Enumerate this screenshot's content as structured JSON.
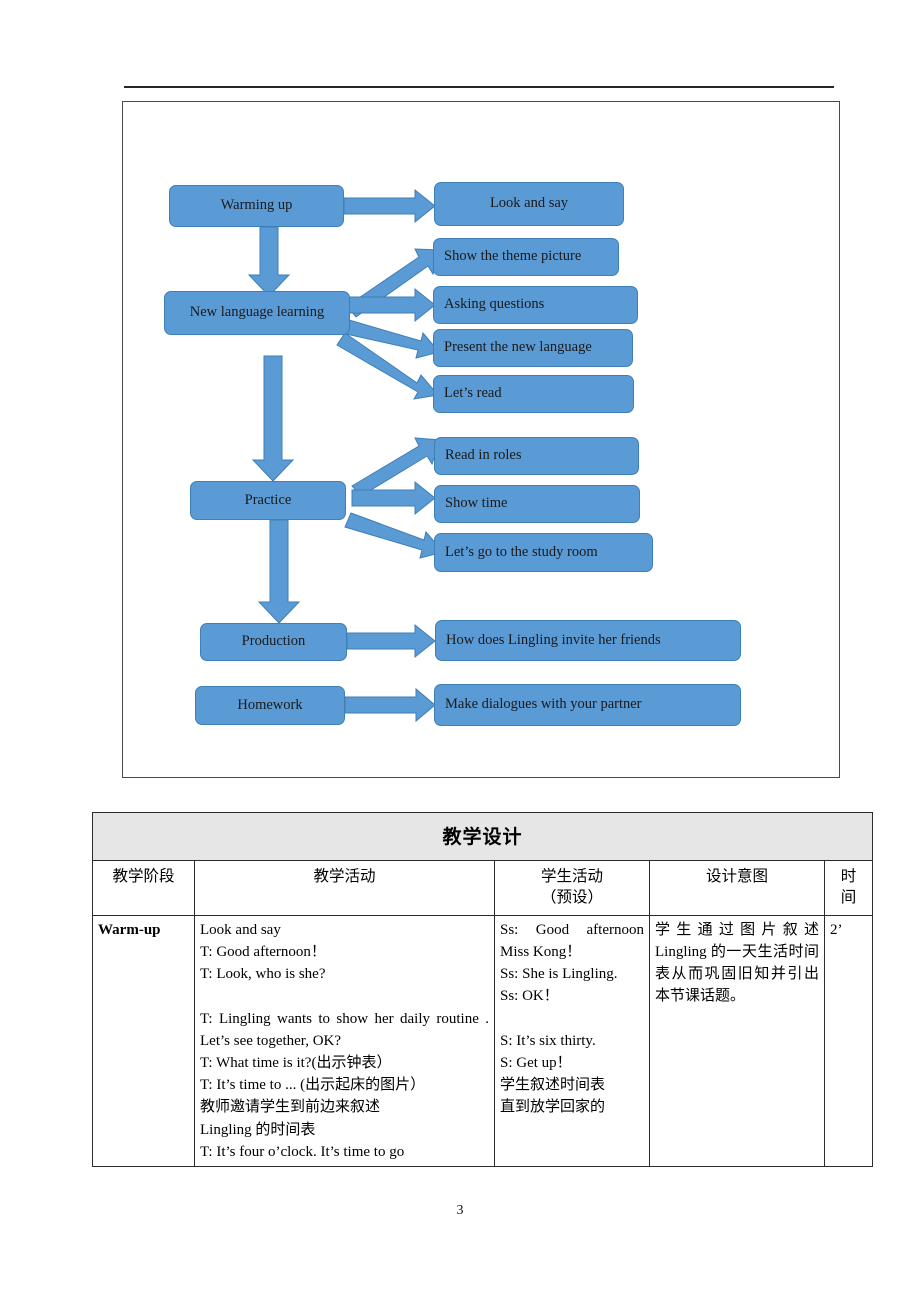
{
  "page": {
    "number": "3",
    "paper_background": "#ffffff"
  },
  "theme": {
    "box_fill": "#5B9BD5",
    "box_stroke": "#3E7FB5",
    "arrow_fill": "#5B9BD5",
    "arrow_stroke": "#3E7FB5",
    "table_header_fill": "#e6e6e6",
    "rule_color": "#262626"
  },
  "diagram": {
    "name": "lesson-procedure-flowchart",
    "stages": [
      {
        "id": "warming-up",
        "label": "Warming up"
      },
      {
        "id": "new-language-learning",
        "label": "New language learning"
      },
      {
        "id": "practice",
        "label": "Practice"
      },
      {
        "id": "production",
        "label": "Production"
      },
      {
        "id": "homework",
        "label": "Homework"
      }
    ],
    "activities": [
      {
        "id": "look-and-say",
        "label": "Look and say",
        "from": "warming-up"
      },
      {
        "id": "show-the-theme-picture",
        "label": "Show the theme picture",
        "from": "new-language-learning"
      },
      {
        "id": "asking-questions",
        "label": "Asking questions",
        "from": "new-language-learning"
      },
      {
        "id": "present-the-new-language",
        "label": "Present the new language",
        "from": "new-language-learning"
      },
      {
        "id": "lets-read",
        "label": "Let’s read",
        "from": "new-language-learning"
      },
      {
        "id": "read-in-roles",
        "label": "Read in roles",
        "from": "practice"
      },
      {
        "id": "show-time",
        "label": "Show time",
        "from": "practice"
      },
      {
        "id": "lets-go-to-the-study-room",
        "label": "Let’s go to the study room",
        "from": "practice"
      },
      {
        "id": "how-does-lingling-invite-her-friends",
        "label": "How does Lingling invite her friends",
        "from": "production"
      },
      {
        "id": "make-dialogues-with-your-partner",
        "label": "Make dialogues with your partner",
        "from": "homework"
      }
    ]
  },
  "table": {
    "title": "教学设计",
    "headers": {
      "stage": "教学阶段",
      "activity": "教学活动",
      "student_activity_line1": "学生活动",
      "student_activity_line2": "（预设）",
      "intent": "设计意图",
      "time_line1": "时",
      "time_line2": "间"
    },
    "rows": [
      {
        "stage": "Warm-up",
        "activity_lines": [
          "Look and say",
          "T: Good afternoon！",
          "T: Look, who is she?",
          "",
          "T: Lingling wants to show her daily routine . Let’s see together, OK?",
          "T: What time is it?(出示钟表）",
          "T: It’s time to ... (出示起床的图片）",
          "教师邀请学生到前边来叙述",
          "Lingling 的时间表",
          "T: It’s four o’clock. It’s time to go"
        ],
        "student_lines": [
          "Ss:            Good afternoon    Miss Kong！",
          "Ss:      She     is Lingling.",
          "Ss: OK！",
          "",
          "S: It’s six thirty.",
          "S: Get up！",
          "学生叙述时间表",
          "直到放学回家的"
        ],
        "intent": "学生通过图片叙述 Lingling 的一天生活时间表从而巩固旧知并引出本节课话题。",
        "time": "2’"
      }
    ]
  }
}
